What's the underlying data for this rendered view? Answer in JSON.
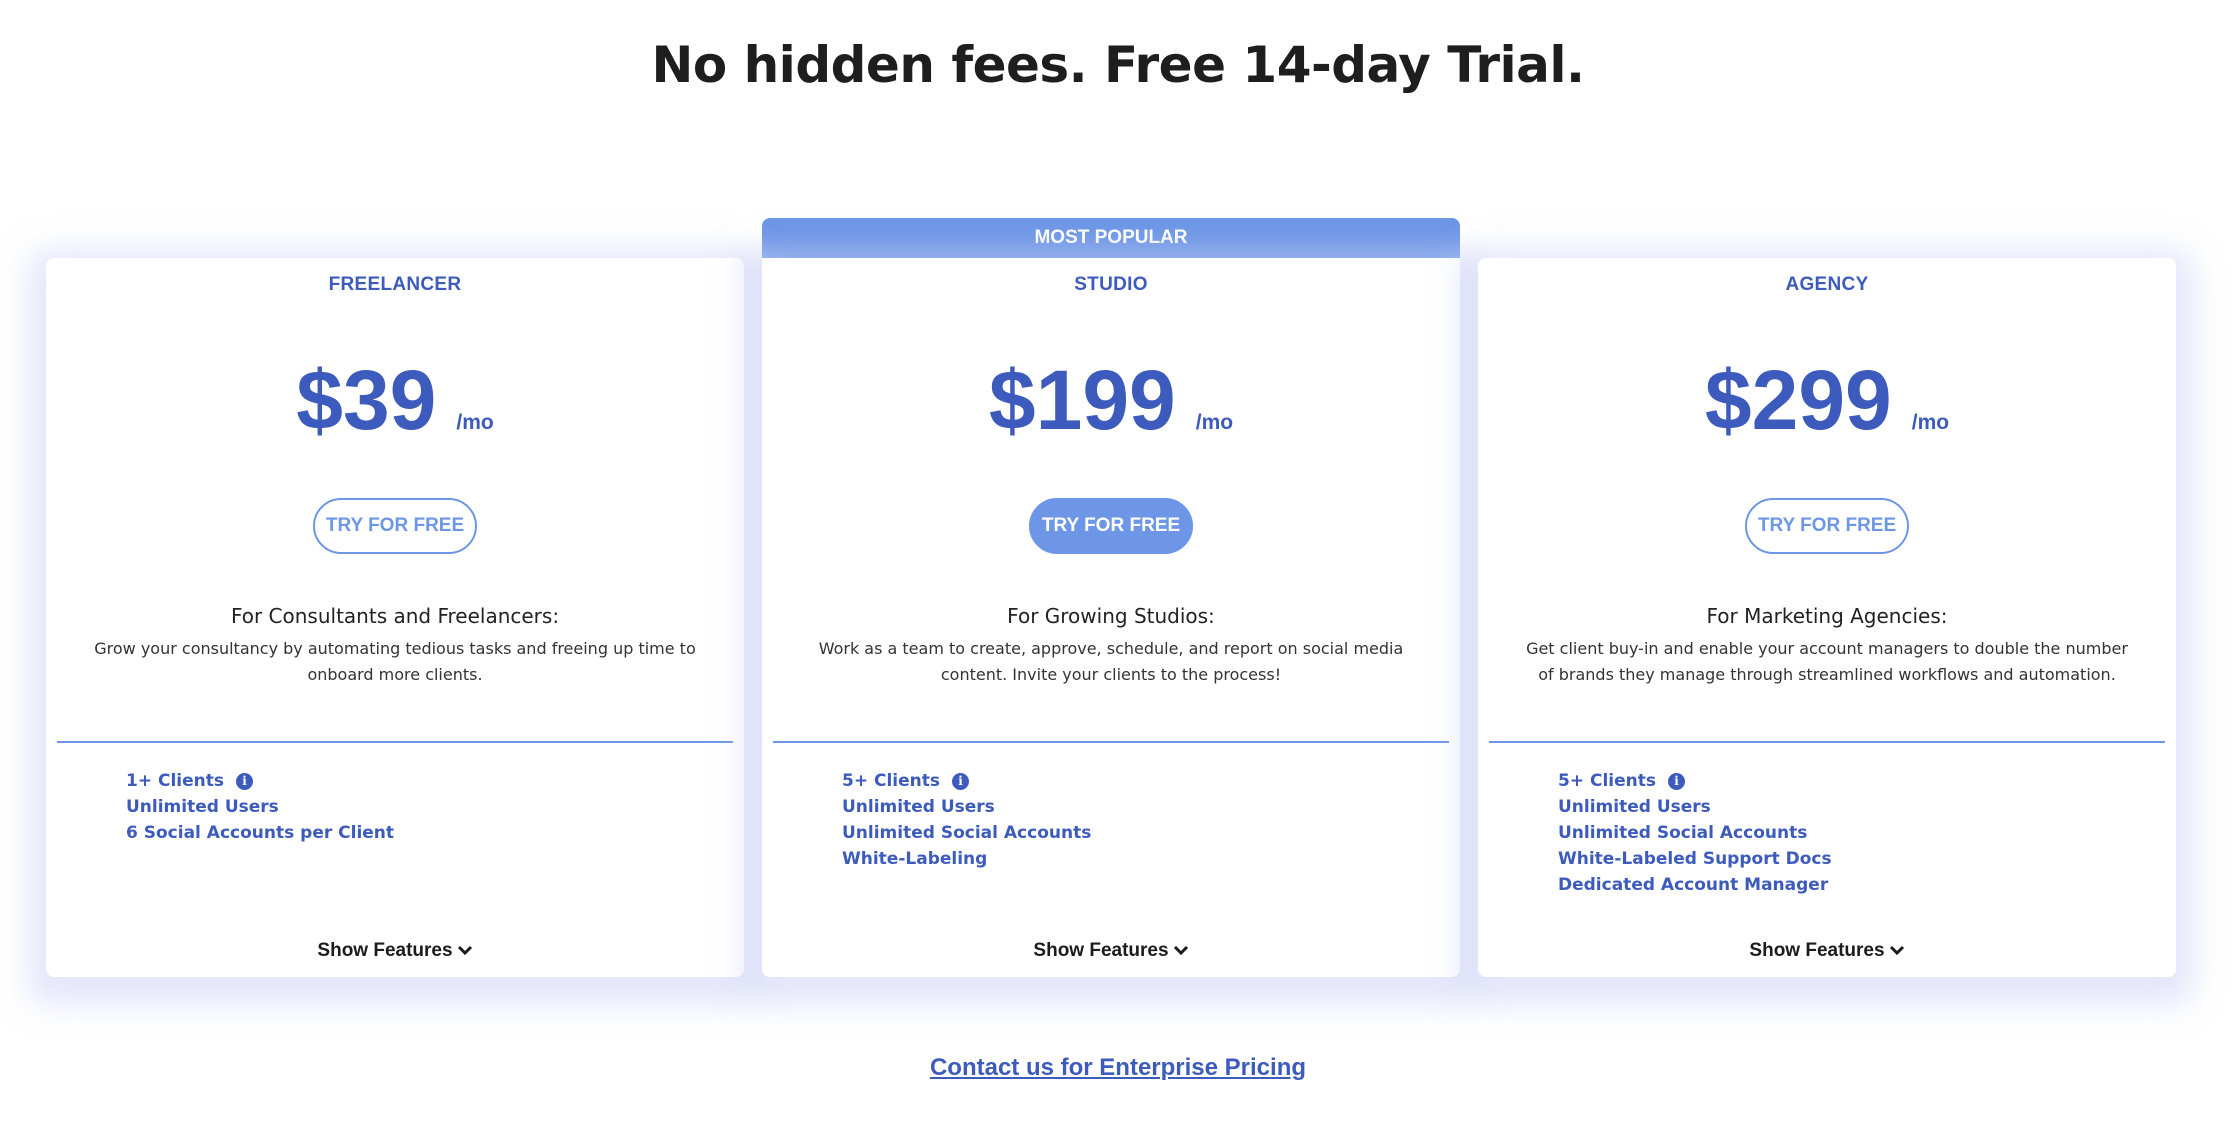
{
  "header": {
    "title": "No hidden fees. Free 14-day Trial."
  },
  "colors": {
    "accent": "#6d96e6",
    "brand_text": "#3c5bbd",
    "title": "#1e1e1e"
  },
  "plans": [
    {
      "name": "FREELANCER",
      "price": "$39",
      "period": "/mo",
      "cta": "TRY FOR FREE",
      "cta_style": "outline",
      "desc_heading": "For Consultants and Freelancers:",
      "desc_body": "Grow your consultancy by automating tedious tasks and freeing up time to onboard more clients.",
      "features": [
        "1+ Clients",
        "Unlimited Users",
        "6 Social Accounts per Client"
      ],
      "show_features": "Show Features"
    },
    {
      "banner": "MOST POPULAR",
      "name": "STUDIO",
      "price": "$199",
      "period": "/mo",
      "cta": "TRY FOR FREE",
      "cta_style": "filled",
      "desc_heading": "For Growing Studios:",
      "desc_body": "Work as a team to create, approve, schedule, and report on social media content. Invite your clients to the process!",
      "features": [
        "5+ Clients",
        "Unlimited Users",
        "Unlimited Social Accounts",
        "White-Labeling"
      ],
      "show_features": "Show Features"
    },
    {
      "name": "AGENCY",
      "price": "$299",
      "period": "/mo",
      "cta": "TRY FOR FREE",
      "cta_style": "outline",
      "desc_heading": "For Marketing Agencies:",
      "desc_body": "Get client buy-in and enable your account managers to double the number of brands they manage through streamlined workflows and automation.",
      "features": [
        "5+ Clients",
        "Unlimited Users",
        "Unlimited Social Accounts",
        "White-Labeled Support Docs",
        "Dedicated Account Manager"
      ],
      "show_features": "Show Features"
    }
  ],
  "icons": {
    "info": "info-circle-icon",
    "chevron": "chevron-down-icon"
  },
  "footer": {
    "enterprise_link": "Contact us for Enterprise Pricing"
  }
}
